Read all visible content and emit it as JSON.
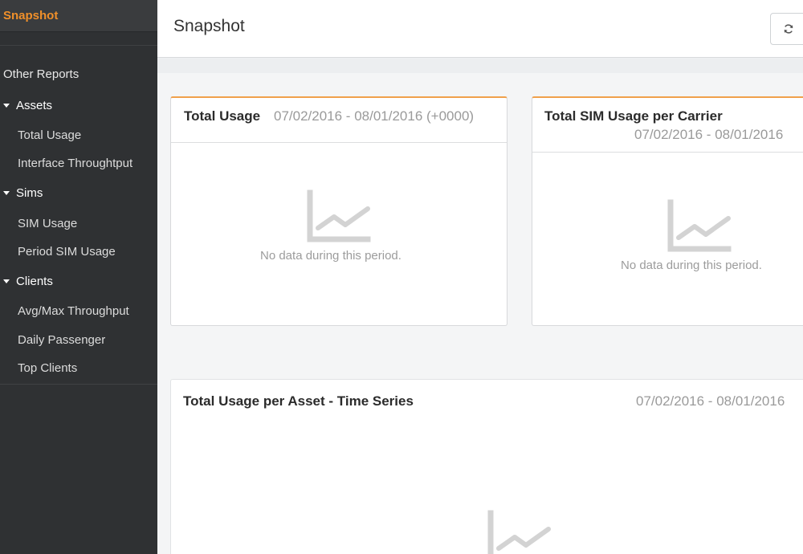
{
  "sidebar": {
    "active_item": "Snapshot",
    "section_heading": "Other Reports",
    "groups": [
      {
        "label": "Assets",
        "items": [
          "Total Usage",
          "Interface Throughtput"
        ]
      },
      {
        "label": "Sims",
        "items": [
          "SIM Usage",
          "Period SIM Usage"
        ]
      },
      {
        "label": "Clients",
        "items": [
          "Avg/Max Throughput",
          "Daily Passenger",
          "Top Clients"
        ]
      }
    ]
  },
  "header": {
    "title": "Snapshot",
    "refresh_icon": "refresh-icon"
  },
  "cards": [
    {
      "title": "Total Usage",
      "date_range": "07/02/2016 - 08/01/2016 (+0000)",
      "empty_text": "No data during this period.",
      "icon": "line-chart-icon"
    },
    {
      "title": "Total SIM Usage per Carrier",
      "date_range": "07/02/2016 - 08/01/2016",
      "empty_text": "No data during this period.",
      "icon": "line-chart-icon"
    },
    {
      "title": "Total Usage per Asset - Time Series",
      "date_range": "07/02/2016 - 08/01/2016",
      "icon": "line-chart-icon"
    }
  ],
  "colors": {
    "accent": "#f0902a",
    "sidebar_bg": "#2f3133",
    "card_accent": "#f0a04b"
  }
}
